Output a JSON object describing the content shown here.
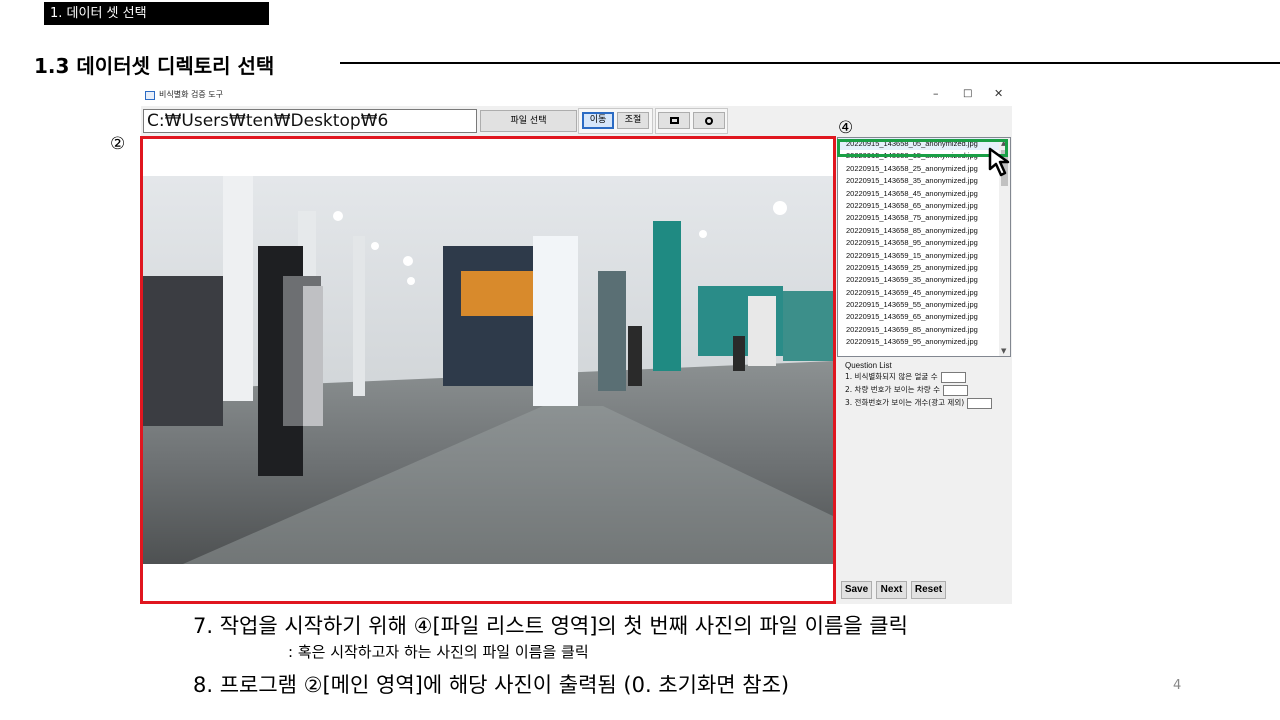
{
  "section_tag": "1. 데이터 셋 선택",
  "heading": "1.3 데이터셋 디렉토리 선택",
  "window": {
    "title": "비식별화 검증 도구",
    "minimize": "–",
    "maximize": "□",
    "close": "✕",
    "path_value": "C:₩Users₩ten₩Desktop₩6",
    "file_select_label": "파일 선택",
    "mode_move_label": "이동",
    "mode_adjust_label": "조절",
    "shape_rect_icon": "rectangle-icon",
    "shape_circle_icon": "circle-icon",
    "file_list": [
      "20220915_143658_05_anonymized.jpg",
      "20220915_143658_15_anonymized.jpg",
      "20220915_143658_25_anonymized.jpg",
      "20220915_143658_35_anonymized.jpg",
      "20220915_143658_45_anonymized.jpg",
      "20220915_143658_65_anonymized.jpg",
      "20220915_143658_75_anonymized.jpg",
      "20220915_143658_85_anonymized.jpg",
      "20220915_143658_95_anonymized.jpg",
      "20220915_143659_15_anonymized.jpg",
      "20220915_143659_25_anonymized.jpg",
      "20220915_143659_35_anonymized.jpg",
      "20220915_143659_45_anonymized.jpg",
      "20220915_143659_55_anonymized.jpg",
      "20220915_143659_65_anonymized.jpg",
      "20220915_143659_85_anonymized.jpg",
      "20220915_143659_95_anonymized.jpg"
    ],
    "question_list": {
      "title": "Question List",
      "items": [
        "1. 비식별화되지 않은 얼굴 수",
        "2. 차량 번호가 보이는 차량 수",
        "3. 전화번호가 보이는 개수(광고 제외)"
      ]
    },
    "save_label": "Save",
    "next_label": "Next",
    "reset_label": "Reset"
  },
  "markers": {
    "main": "②",
    "list": "④"
  },
  "instructions": {
    "step7": "7. 작업을 시작하기 위해 ④[파일 리스트 영역]의 첫 번째 사진의 파일 이름을 클릭",
    "note": ": 혹은 시작하고자 하는 사진의 파일 이름을 클릭",
    "step8": "8. 프로그램 ②[메인 영역]에 해당 사진이 출력됨 (0. 초기화면 참조)"
  },
  "page_number": "4",
  "colors": {
    "highlight_red": "#e0161f",
    "highlight_green": "#1a9f45",
    "active_blue": "#2b6bc4"
  }
}
